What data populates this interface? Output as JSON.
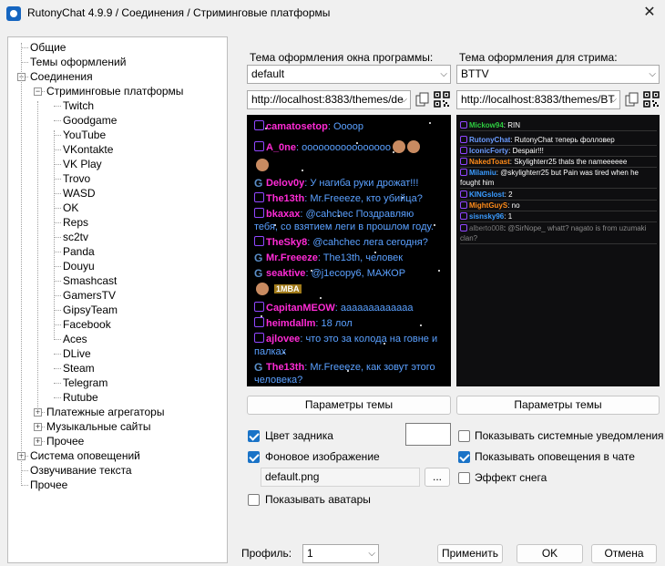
{
  "window": {
    "title": "RutonyChat 4.9.9 / Соединения / Стриминговые платформы",
    "close": "✕"
  },
  "tree": {
    "items": [
      {
        "label": "Общие",
        "level": 0
      },
      {
        "label": "Темы оформлений",
        "level": 0
      },
      {
        "label": "Соединения",
        "level": 0,
        "expander": "−"
      },
      {
        "label": "Стриминговые платформы",
        "level": 1,
        "expander": "−"
      },
      {
        "label": "Twitch",
        "level": 2
      },
      {
        "label": "Goodgame",
        "level": 2
      },
      {
        "label": "YouTube",
        "level": 2
      },
      {
        "label": "VKontakte",
        "level": 2
      },
      {
        "label": "VK Play",
        "level": 2
      },
      {
        "label": "Trovo",
        "level": 2
      },
      {
        "label": "WASD",
        "level": 2
      },
      {
        "label": "OK",
        "level": 2
      },
      {
        "label": "Reps",
        "level": 2
      },
      {
        "label": "sc2tv",
        "level": 2
      },
      {
        "label": "Panda",
        "level": 2
      },
      {
        "label": "Douyu",
        "level": 2
      },
      {
        "label": "Smashcast",
        "level": 2
      },
      {
        "label": "GamersTV",
        "level": 2
      },
      {
        "label": "GipsyTeam",
        "level": 2
      },
      {
        "label": "Facebook",
        "level": 2
      },
      {
        "label": "Aces",
        "level": 2
      },
      {
        "label": "DLive",
        "level": 2
      },
      {
        "label": "Steam",
        "level": 2
      },
      {
        "label": "Telegram",
        "level": 2
      },
      {
        "label": "Rutube",
        "level": 2
      },
      {
        "label": "Платежные агрегаторы",
        "level": 1,
        "expander": "+"
      },
      {
        "label": "Музыкальные сайты",
        "level": 1,
        "expander": "+"
      },
      {
        "label": "Прочее",
        "level": 1,
        "expander": "+"
      },
      {
        "label": "Система оповещений",
        "level": 0,
        "expander": "+"
      },
      {
        "label": "Озвучивание текста",
        "level": 0
      },
      {
        "label": "Прочее",
        "level": 0
      }
    ]
  },
  "left_panel": {
    "theme_label": "Тема оформления окна программы:",
    "theme_value": "default",
    "url_value": "http://localhost:8383/themes/de",
    "params_button": "Параметры темы",
    "chat": [
      {
        "platform": "twitch",
        "user": "camatosetop",
        "text": "Оооор",
        "ucolor": "#ff2bd6",
        "tcolor": "#5aa0ff"
      },
      {
        "platform": "twitch",
        "user": "A_0ne",
        "text": "оооооооооооооооо",
        "ucolor": "#ff2bd6",
        "tcolor": "#5aa0ff"
      },
      {
        "platform": "goodgame",
        "user": "Delov0y",
        "text": "У нагиба руки дрожат!!!",
        "ucolor": "#ff2bd6",
        "tcolor": "#5aa0ff"
      },
      {
        "platform": "twitch",
        "user": "The13th",
        "text": "Mr.Freeeze, кто убийца?",
        "ucolor": "#ff2bd6",
        "tcolor": "#5aa0ff"
      },
      {
        "platform": "twitch",
        "user": "bkaxax",
        "text": "@cahchec Поздравляю тебя, со взятием леги в прошлом году.",
        "ucolor": "#ff2bd6",
        "tcolor": "#5aa0ff"
      },
      {
        "platform": "twitch",
        "user": "TheSky8",
        "text": "@cahchec лега сегодня?",
        "ucolor": "#ff2bd6",
        "tcolor": "#5aa0ff"
      },
      {
        "platform": "goodgame",
        "user": "Mr.Freeeze",
        "text": "The13th, человек",
        "ucolor": "#ff2bd6",
        "tcolor": "#5aa0ff"
      },
      {
        "platform": "goodgame",
        "user": "seaktive",
        "text": "@j1ecoру6, МАЖОР",
        "ucolor": "#ff2bd6",
        "tcolor": "#5aa0ff"
      },
      {
        "platform": "twitch",
        "user": "CapitanMEOW",
        "text": "ааааааааааааа",
        "ucolor": "#ff2bd6",
        "tcolor": "#5aa0ff"
      },
      {
        "platform": "twitch",
        "user": "heimdallm",
        "text": "18 лол",
        "ucolor": "#ff2bd6",
        "tcolor": "#5aa0ff"
      },
      {
        "platform": "twitch",
        "user": "ajlovee",
        "text": "что это за колода на говне и палках",
        "ucolor": "#ff2bd6",
        "tcolor": "#5aa0ff"
      },
      {
        "platform": "goodgame",
        "user": "The13th",
        "text": "Mr.Freeeze, как зовут этого человека?",
        "ucolor": "#ff2bd6",
        "tcolor": "#5aa0ff"
      }
    ],
    "badge_1mba": "1MBA"
  },
  "right_panel": {
    "theme_label": "Тема оформления для стрима:",
    "theme_value": "BTTV",
    "url_value": "http://localhost:8383/themes/BT",
    "params_button": "Параметры темы",
    "chat": [
      {
        "user": "Mickow94",
        "text": "RIN",
        "ucolor": "#2ecc40"
      },
      {
        "user": "RutonyChat",
        "text": "RutonyChat теперь фолловер",
        "ucolor": "#6b9cff"
      },
      {
        "user": "IconicForty",
        "text": "Despair!!!",
        "ucolor": "#6b9cff"
      },
      {
        "user": "NakedToast",
        "text": "Skylighterr25 thats the nameeeeee",
        "ucolor": "#ff8c1a"
      },
      {
        "user": "Milamiu",
        "text": "@skylighterr25 but Pain was tired when he fought him",
        "ucolor": "#3a9bff"
      },
      {
        "user": "KINGslost",
        "text": "2",
        "ucolor": "#3a9bff"
      },
      {
        "user": "MightGuyS",
        "text": "no",
        "ucolor": "#ff8c1a"
      },
      {
        "user": "sisnsky96",
        "text": "1",
        "ucolor": "#3a9bff"
      },
      {
        "user": "alberto008",
        "text": "@SirNope_ whatt? nagato is from uzumaki clan?",
        "ucolor": "#777777"
      }
    ]
  },
  "options": {
    "bg_color_label": "Цвет задника",
    "bg_color_checked": true,
    "bg_image_label": "Фоновое изображение",
    "bg_image_checked": true,
    "file_value": "default.png",
    "browse_label": "...",
    "avatars_label": "Показывать аватары",
    "avatars_checked": false,
    "sys_notif_label": "Показывать системные уведомления",
    "sys_notif_checked": false,
    "alerts_label": "Показывать оповещения в чате",
    "alerts_checked": true,
    "snow_label": "Эффект снега",
    "snow_checked": false
  },
  "footer": {
    "profile_label": "Профиль:",
    "profile_value": "1",
    "apply": "Применить",
    "ok": "OK",
    "cancel": "Отмена"
  },
  "colors": {
    "accent": "#1a73c7",
    "twitch": "#9147ff",
    "username": "#ff2bd6",
    "message": "#5aa0ff"
  }
}
